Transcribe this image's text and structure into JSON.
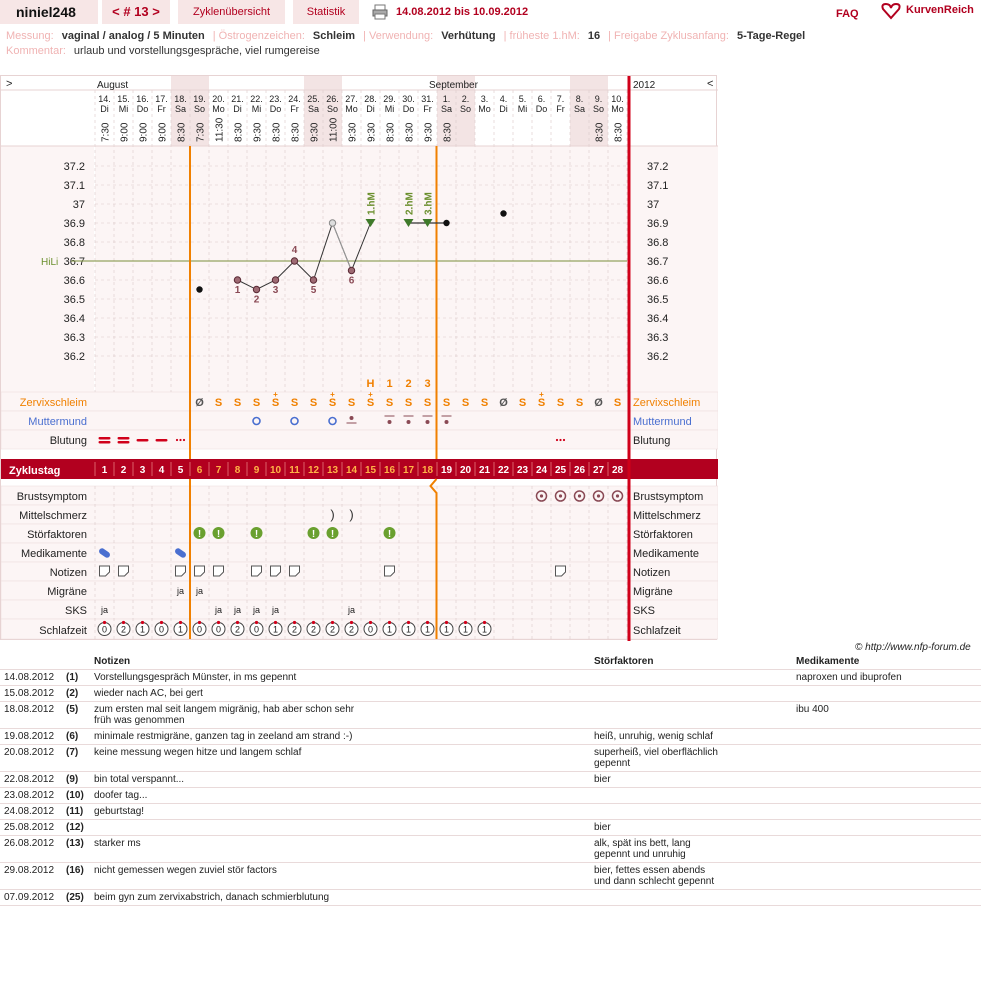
{
  "header": {
    "username": "niniel248",
    "cycle_label": "< # 13 >",
    "tabs": [
      "Zyklenübersicht",
      "Statistik"
    ],
    "date_range": "14.08.2012 bis 10.09.2012",
    "faq": "FAQ",
    "brand": "KurvenReich"
  },
  "meta": {
    "line1": [
      {
        "k": "Messung:",
        "v": "vaginal / analog / 5 Minuten"
      },
      {
        "k": "Östrogenzeichen:",
        "v": "Schleim"
      },
      {
        "k": "Verwendung:",
        "v": "Verhütung"
      },
      {
        "k": "früheste 1.hM:",
        "v": "16"
      },
      {
        "k": "Freigabe Zyklusanfang:",
        "v": "5-Tage-Regel"
      }
    ],
    "comment_key": "Kommentar:",
    "comment": "urlaub und vorstellungsgespräche, viel rumgereise"
  },
  "chart_data": {
    "type": "line",
    "title": "",
    "months": [
      "August",
      "September"
    ],
    "year": "2012",
    "nav_left": ">",
    "nav_right": "<",
    "dates": [
      "14.",
      "15.",
      "16.",
      "17.",
      "18.",
      "19.",
      "20.",
      "21.",
      "22.",
      "23.",
      "24.",
      "25.",
      "26.",
      "27.",
      "28.",
      "29.",
      "30.",
      "31.",
      "1.",
      "2.",
      "3.",
      "4.",
      "5.",
      "6.",
      "7.",
      "8.",
      "9.",
      "10."
    ],
    "weekdays": [
      "Di",
      "Mi",
      "Do",
      "Fr",
      "Sa",
      "So",
      "Mo",
      "Di",
      "Mi",
      "Do",
      "Fr",
      "Sa",
      "So",
      "Mo",
      "Di",
      "Mi",
      "Do",
      "Fr",
      "Sa",
      "So",
      "Mo",
      "Di",
      "Mi",
      "Do",
      "Fr",
      "Sa",
      "So",
      "Mo"
    ],
    "times": [
      "7:30",
      "9:00",
      "9:00",
      "9:00",
      "8:30",
      "7:30",
      "11:30",
      "8:30",
      "9:30",
      "8:30",
      "8:30",
      "9:30",
      "11:00",
      "9:30",
      "9:30",
      "8:30",
      "8:30",
      "9:30",
      "8:30",
      "",
      "",
      "",
      "",
      "",
      "",
      "",
      "8:30",
      "8:30"
    ],
    "weekend_days": [
      4,
      5,
      11,
      12,
      18,
      19,
      25,
      26
    ],
    "temps": [
      null,
      null,
      null,
      null,
      null,
      36.55,
      null,
      36.6,
      36.55,
      36.6,
      36.7,
      36.6,
      36.9,
      36.65,
      36.9,
      null,
      36.9,
      36.9,
      36.9,
      null,
      null,
      36.95,
      null,
      null,
      null,
      null,
      null,
      null
    ],
    "low_labels": {
      "7": "1",
      "8": "2",
      "9": "3",
      "10": "4",
      "11": "5",
      "13": "6"
    },
    "hm_labels": {
      "14": "1.hM",
      "16": "2.hM",
      "17": "3.hM"
    },
    "hili": 36.7,
    "hili_label": "HiLi",
    "ylim": [
      36.1,
      37.3
    ],
    "yticks": [
      37.2,
      37.1,
      37.0,
      36.9,
      36.8,
      36.7,
      36.6,
      36.5,
      36.4,
      36.3,
      36.2
    ],
    "ytick_labels": [
      "37.2",
      "37.1",
      "37",
      "36.9",
      "36.8",
      "36.7",
      "36.6",
      "36.5",
      "36.4",
      "36.3",
      "36.2"
    ],
    "peak_labels": {
      "14": "H",
      "15": "1",
      "16": "2",
      "17": "3"
    },
    "cervix": [
      "",
      "",
      "",
      "",
      "",
      "Ø",
      "S",
      "S",
      "S",
      "S",
      "S",
      "S",
      "S",
      "S",
      "S",
      "S",
      "S",
      "S",
      "S",
      "S",
      "S",
      "Ø",
      "S",
      "S",
      "S",
      "S",
      "Ø",
      "S"
    ],
    "cycle_days": [
      "1",
      "2",
      "3",
      "4",
      "5",
      "6",
      "7",
      "8",
      "9",
      "10",
      "11",
      "12",
      "13",
      "14",
      "15",
      "16",
      "17",
      "18",
      "19",
      "20",
      "21",
      "22",
      "23",
      "24",
      "25",
      "26",
      "27",
      "28"
    ],
    "sks": [
      "ja",
      "",
      "",
      "",
      "",
      "",
      "ja",
      "ja",
      "ja",
      "ja",
      "",
      "",
      "",
      "ja",
      "",
      "",
      "",
      "",
      "",
      "",
      "",
      "",
      "",
      "",
      "",
      "",
      "",
      ""
    ],
    "migraene": [
      "",
      "",
      "",
      "",
      "ja",
      "ja",
      "",
      "",
      "",
      "",
      "",
      "",
      "",
      "",
      "",
      "",
      "",
      "",
      "",
      "",
      "",
      "",
      "",
      "",
      "",
      "",
      "",
      ""
    ],
    "schlaf": [
      "0",
      "2",
      "1",
      "0",
      "1",
      "0",
      "0",
      "2",
      "0",
      "1",
      "2",
      "2",
      "2",
      "2",
      "0",
      "1",
      "1",
      "1",
      "1",
      "1",
      "1",
      "",
      "",
      "",
      "",
      "",
      "",
      ""
    ],
    "rows_left": [
      "Zervixschleim",
      "Muttermund",
      "Blutung",
      "Zyklustag",
      "Brustsymptom",
      "Mittelschmerz",
      "Störfaktoren",
      "Medikamente",
      "Notizen",
      "Migräne",
      "SKS",
      "Schlafzeit"
    ]
  },
  "copyright": "© http://www.nfp-forum.de",
  "notes": {
    "headers": [
      "Notizen",
      "Störfaktoren",
      "Medikamente"
    ],
    "rows": [
      {
        "date": "14.08.2012",
        "day": "(1)",
        "note": "Vorstellungsgespräch Münster, in ms gepennt",
        "stoer": "",
        "med": "naproxen und ibuprofen"
      },
      {
        "date": "15.08.2012",
        "day": "(2)",
        "note": "wieder nach AC, bei gert",
        "stoer": "",
        "med": ""
      },
      {
        "date": "18.08.2012",
        "day": "(5)",
        "note": "zum ersten mal seit langem migränig, hab aber schon sehr früh was genommen",
        "stoer": "",
        "med": "ibu 400"
      },
      {
        "date": "19.08.2012",
        "day": "(6)",
        "note": "minimale restmigräne, ganzen tag in zeeland am strand :-)",
        "stoer": "heiß, unruhig, wenig schlaf",
        "med": ""
      },
      {
        "date": "20.08.2012",
        "day": "(7)",
        "note": "keine messung wegen hitze und langem schlaf",
        "stoer": "superheiß, viel oberflächlich gepennt",
        "med": ""
      },
      {
        "date": "22.08.2012",
        "day": "(9)",
        "note": "bin total verspannt...",
        "stoer": "bier",
        "med": ""
      },
      {
        "date": "23.08.2012",
        "day": "(10)",
        "note": "doofer tag...",
        "stoer": "",
        "med": ""
      },
      {
        "date": "24.08.2012",
        "day": "(11)",
        "note": "geburtstag!",
        "stoer": "",
        "med": ""
      },
      {
        "date": "25.08.2012",
        "day": "(12)",
        "note": "",
        "stoer": "bier",
        "med": ""
      },
      {
        "date": "26.08.2012",
        "day": "(13)",
        "note": "starker ms",
        "stoer": "alk, spät ins bett, lang gepennt und unruhig",
        "med": ""
      },
      {
        "date": "29.08.2012",
        "day": "(16)",
        "note": "nicht gemessen wegen zuviel stör factors",
        "stoer": "bier, fettes essen abends und dann schlecht gepennt",
        "med": ""
      },
      {
        "date": "07.09.2012",
        "day": "(25)",
        "note": "beim gyn zum zervixabstrich, danach schmierblutung",
        "stoer": "",
        "med": ""
      }
    ]
  },
  "colors": {
    "accent": "#b2001f",
    "orange": "#f08000",
    "green": "#6a8f2c",
    "blue": "#4a6fd0",
    "plum": "#7a3a4a"
  }
}
